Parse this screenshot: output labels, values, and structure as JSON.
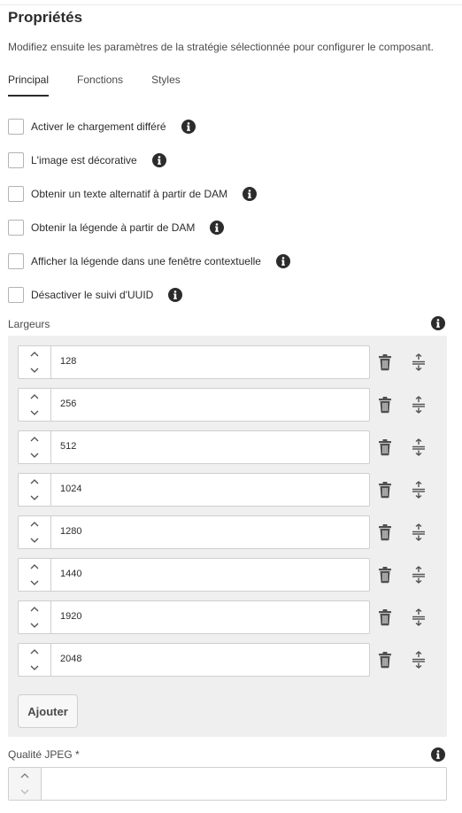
{
  "header": {
    "title": "Propriétés",
    "description": "Modifiez ensuite les paramètres de la stratégie sélectionnée pour configurer le composant."
  },
  "tabs": [
    {
      "label": "Principal",
      "active": true
    },
    {
      "label": "Fonctions",
      "active": false
    },
    {
      "label": "Styles",
      "active": false
    }
  ],
  "checkboxes": [
    {
      "label": "Activer le chargement différé",
      "checked": false
    },
    {
      "label": "L'image est décorative",
      "checked": false
    },
    {
      "label": "Obtenir un texte alternatif à partir de DAM",
      "checked": false
    },
    {
      "label": "Obtenir la légende à partir de DAM",
      "checked": false
    },
    {
      "label": "Afficher la légende dans une fenêtre contextuelle",
      "checked": false
    },
    {
      "label": "Désactiver le suivi d'UUID",
      "checked": false
    }
  ],
  "widths": {
    "label": "Largeurs",
    "values": [
      "128",
      "256",
      "512",
      "1024",
      "1280",
      "1440",
      "1920",
      "2048"
    ],
    "add_label": "Ajouter"
  },
  "jpeg": {
    "label": "Qualité JPEG *",
    "value": ""
  },
  "icons": {
    "info": "info-icon",
    "delete": "trash-icon",
    "reorder": "drag-handle-icon",
    "stepper_up": "chevron-up-icon",
    "stepper_down": "chevron-down-icon"
  },
  "colors": {
    "text": "#2c2c2c",
    "muted": "#4b4b4b",
    "panel": "#efefef",
    "border": "#cfcfcf",
    "icon": "#505050"
  }
}
